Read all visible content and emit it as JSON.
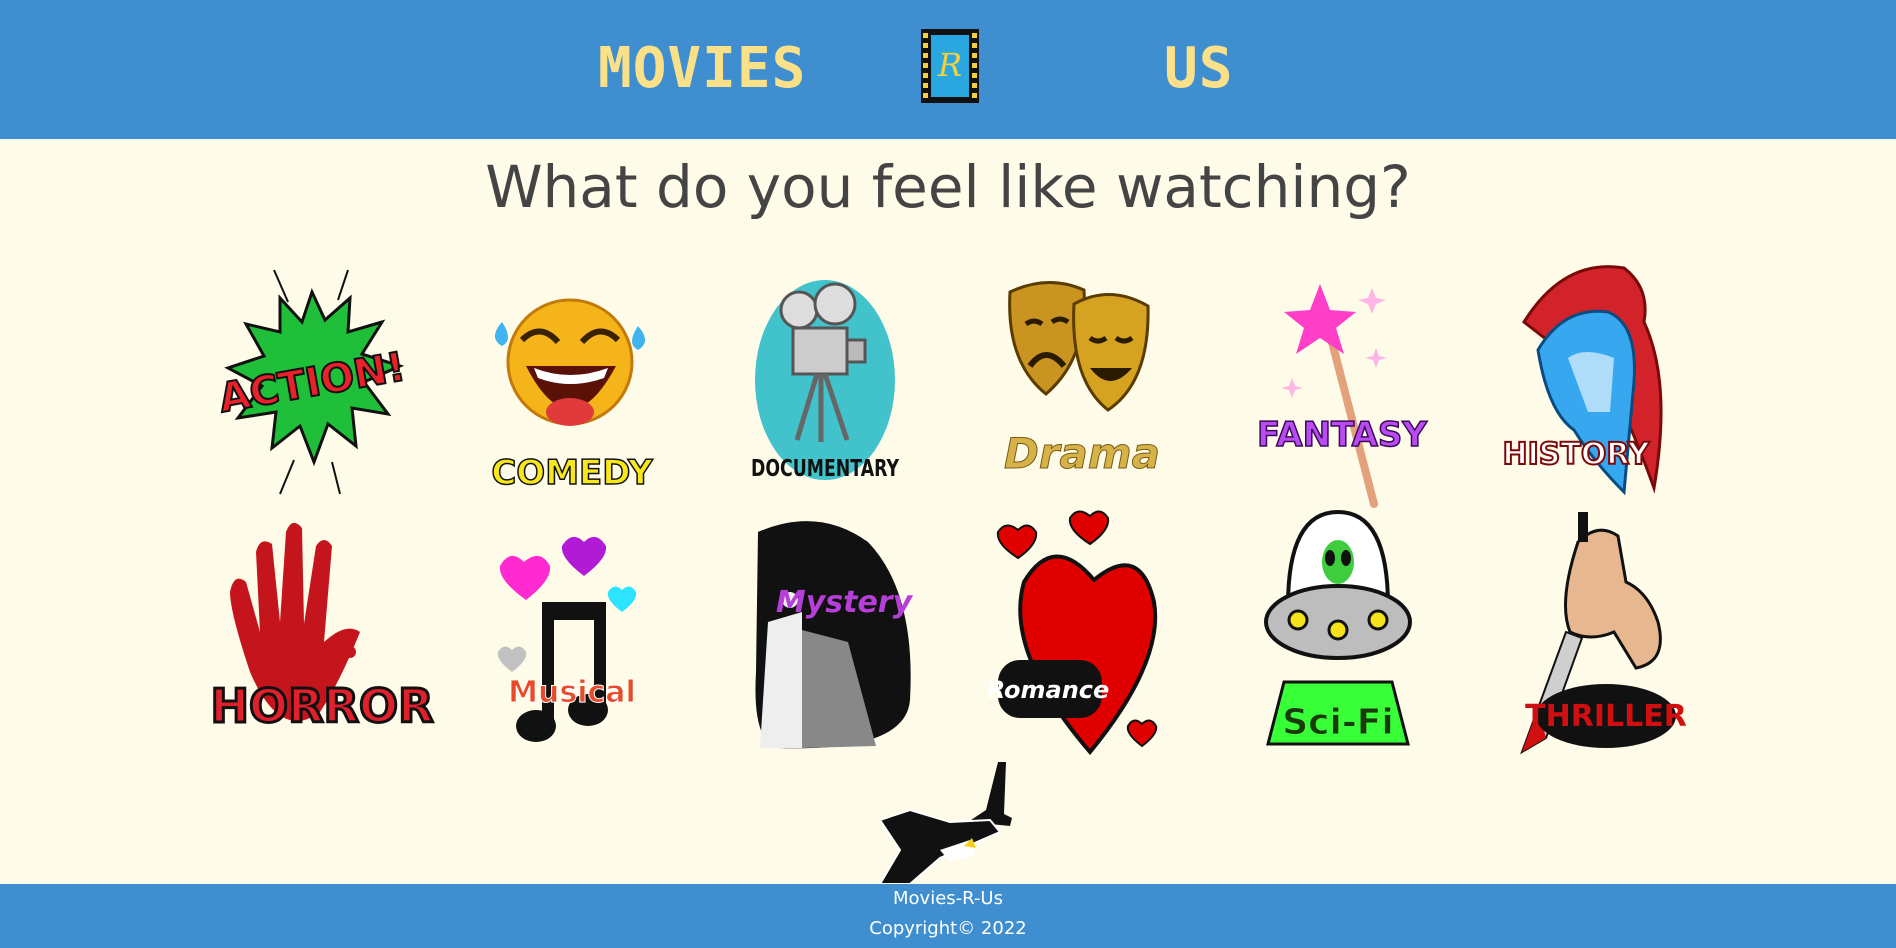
{
  "header": {
    "brand_left": "MOVIES",
    "brand_right": "US",
    "logo_letter": "R"
  },
  "main": {
    "question": "What do you feel like watching?",
    "genres": [
      {
        "label": "ACTION!",
        "icon": "action-burst-icon"
      },
      {
        "label": "COMEDY",
        "icon": "laughing-emoji-icon"
      },
      {
        "label": "DOCUMENTARY",
        "icon": "film-camera-icon"
      },
      {
        "label": "Drama",
        "icon": "theater-masks-icon"
      },
      {
        "label": "FANTASY",
        "icon": "magic-wand-icon"
      },
      {
        "label": "HISTORY",
        "icon": "spartan-helmet-icon"
      },
      {
        "label": "HORROR",
        "icon": "bloody-hand-icon"
      },
      {
        "label": "Musical",
        "icon": "music-note-icon"
      },
      {
        "label": "Mystery",
        "icon": "keyhole-door-icon"
      },
      {
        "label": "Romance",
        "icon": "heart-icon"
      },
      {
        "label": "Sci-Fi",
        "icon": "ufo-alien-icon"
      },
      {
        "label": "THRILLER",
        "icon": "knife-hand-icon"
      }
    ],
    "extra_icon": "airplane-icon"
  },
  "footer": {
    "line1": "Movies-R-Us",
    "line2": "Copyright© 2022"
  },
  "colors": {
    "header_bg": "#3f8ecf",
    "brand_text": "#fbe08a",
    "page_bg": "#fefbe9"
  }
}
